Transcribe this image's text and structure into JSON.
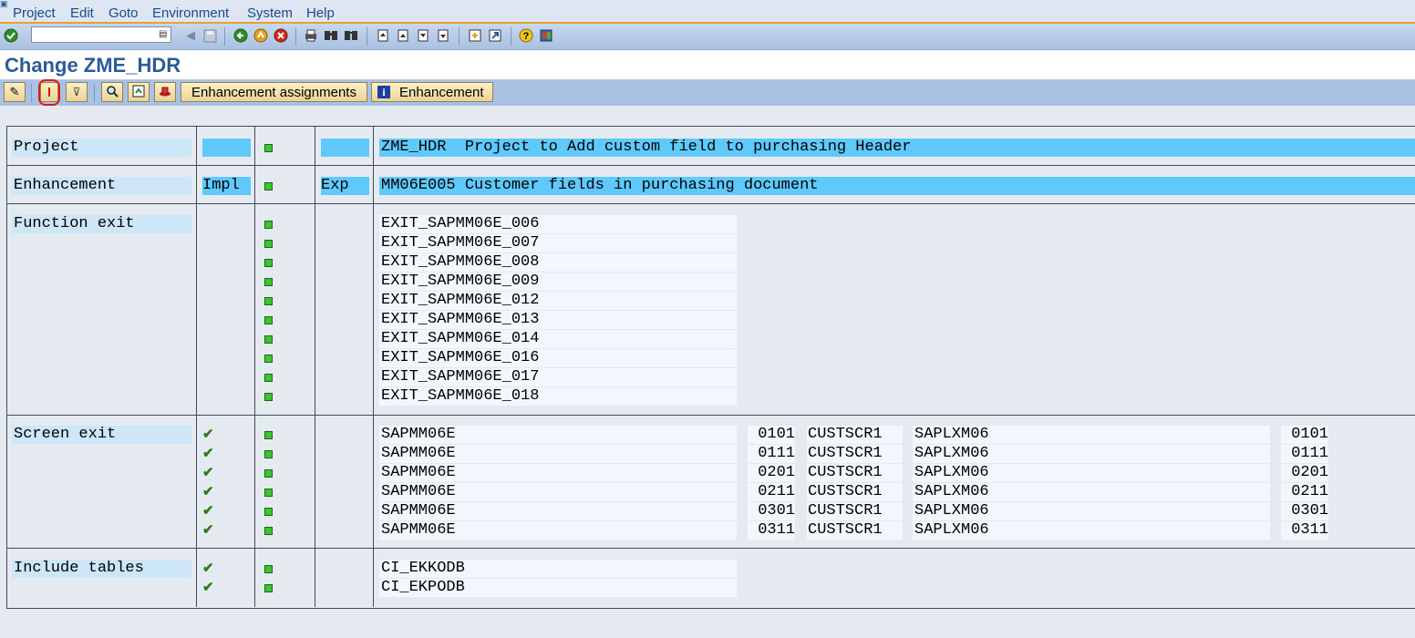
{
  "menu": [
    "Project",
    "Edit",
    "Goto",
    "Environment",
    "System",
    "Help"
  ],
  "toolbar": {
    "command_field_value": "",
    "icons": [
      "enter-icon",
      "back-icon",
      "save-icon",
      "green-back-icon",
      "exit-icon",
      "cancel-icon",
      "print-icon",
      "find-icon",
      "find-next-icon",
      "first-page-icon",
      "prev-page-icon",
      "next-page-icon",
      "last-page-icon",
      "new-session-icon",
      "shortcut-icon",
      "help-icon",
      "layout-icon"
    ]
  },
  "title": "Change ZME_HDR",
  "app_toolbar": {
    "enhancement_assignments_label": "Enhancement assignments",
    "enhancement_label": "Enhancement"
  },
  "project": {
    "label": "Project",
    "name": "ZME_HDR",
    "description": "Project to Add custom field to purchasing Header"
  },
  "enhancement": {
    "label": "Enhancement",
    "impl": "Impl",
    "exp": "Exp",
    "name": "MM06E005",
    "description": "Customer fields in purchasing document"
  },
  "function_exit": {
    "label": "Function exit",
    "items": [
      "EXIT_SAPMM06E_006",
      "EXIT_SAPMM06E_007",
      "EXIT_SAPMM06E_008",
      "EXIT_SAPMM06E_009",
      "EXIT_SAPMM06E_012",
      "EXIT_SAPMM06E_013",
      "EXIT_SAPMM06E_014",
      "EXIT_SAPMM06E_016",
      "EXIT_SAPMM06E_017",
      "EXIT_SAPMM06E_018"
    ]
  },
  "screen_exit": {
    "label": "Screen exit",
    "rows": [
      {
        "program": "SAPMM06E",
        "screen": "0101",
        "area": "CUSTSCR1",
        "sub_program": "SAPLXM06",
        "sub_screen": "0101"
      },
      {
        "program": "SAPMM06E",
        "screen": "0111",
        "area": "CUSTSCR1",
        "sub_program": "SAPLXM06",
        "sub_screen": "0111"
      },
      {
        "program": "SAPMM06E",
        "screen": "0201",
        "area": "CUSTSCR1",
        "sub_program": "SAPLXM06",
        "sub_screen": "0201"
      },
      {
        "program": "SAPMM06E",
        "screen": "0211",
        "area": "CUSTSCR1",
        "sub_program": "SAPLXM06",
        "sub_screen": "0211"
      },
      {
        "program": "SAPMM06E",
        "screen": "0301",
        "area": "CUSTSCR1",
        "sub_program": "SAPLXM06",
        "sub_screen": "0301"
      },
      {
        "program": "SAPMM06E",
        "screen": "0311",
        "area": "CUSTSCR1",
        "sub_program": "SAPLXM06",
        "sub_screen": "0311"
      }
    ]
  },
  "include_tables": {
    "label": "Include tables",
    "items": [
      "CI_EKKODB",
      "CI_EKPODB"
    ]
  },
  "colors": {
    "accent": "#2c5b98",
    "header_field": "#5fc9fb",
    "status_green": "#3dc42f"
  }
}
